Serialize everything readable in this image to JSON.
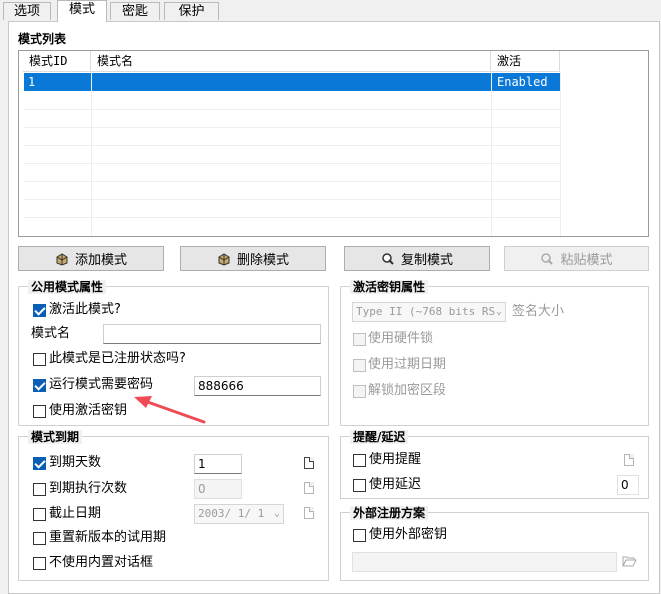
{
  "tabs": [
    "选项",
    "模式",
    "密匙",
    "保护"
  ],
  "active_tab": "模式",
  "mode_list": {
    "title": "模式列表",
    "columns": [
      "模式ID",
      "模式名",
      "激活"
    ],
    "rows": [
      {
        "id": "1",
        "name": "",
        "active": "Enabled"
      }
    ]
  },
  "buttons": {
    "add": "添加模式",
    "delete": "删除模式",
    "copy": "复制模式",
    "paste": "粘贴模式"
  },
  "public_props": {
    "title": "公用模式属性",
    "activate_label": "激活此模式?",
    "activate_checked": true,
    "mode_name_label": "模式名",
    "mode_name_value": "",
    "registered_label": "此模式是已注册状态吗?",
    "registered_checked": false,
    "need_password_label": "运行模式需要密码",
    "need_password_checked": true,
    "password_value": "888666",
    "use_activation_key_label": "使用激活密钥",
    "use_activation_key_checked": false
  },
  "activation_key_props": {
    "title": "激活密钥属性",
    "key_type_value": "Type II  (~768 bits RS",
    "signature_size_label": "签名大小",
    "use_hardware_lock_label": "使用硬件锁",
    "use_expiry_date_label": "使用过期日期",
    "unlock_encrypted_label": "解锁加密区段"
  },
  "expiry": {
    "title": "模式到期",
    "days_label": "到期天数",
    "days_checked": true,
    "days_value": "1",
    "exec_count_label": "到期执行次数",
    "exec_count_checked": false,
    "exec_count_value": "0",
    "end_date_label": "截止日期",
    "end_date_checked": false,
    "end_date_value": "2003/ 1/ 1",
    "reset_trial_label": "重置新版本的试用期",
    "reset_trial_checked": false,
    "no_builtin_dialog_label": "不使用内置对话框",
    "no_builtin_dialog_checked": false
  },
  "reminder": {
    "title": "提醒/延迟",
    "use_reminder_label": "使用提醒",
    "use_reminder_checked": false,
    "use_delay_label": "使用延迟",
    "use_delay_checked": false,
    "delay_value": "0"
  },
  "external_reg": {
    "title": "外部注册方案",
    "use_external_key_label": "使用外部密钥",
    "use_external_key_checked": false,
    "path_value": ""
  }
}
